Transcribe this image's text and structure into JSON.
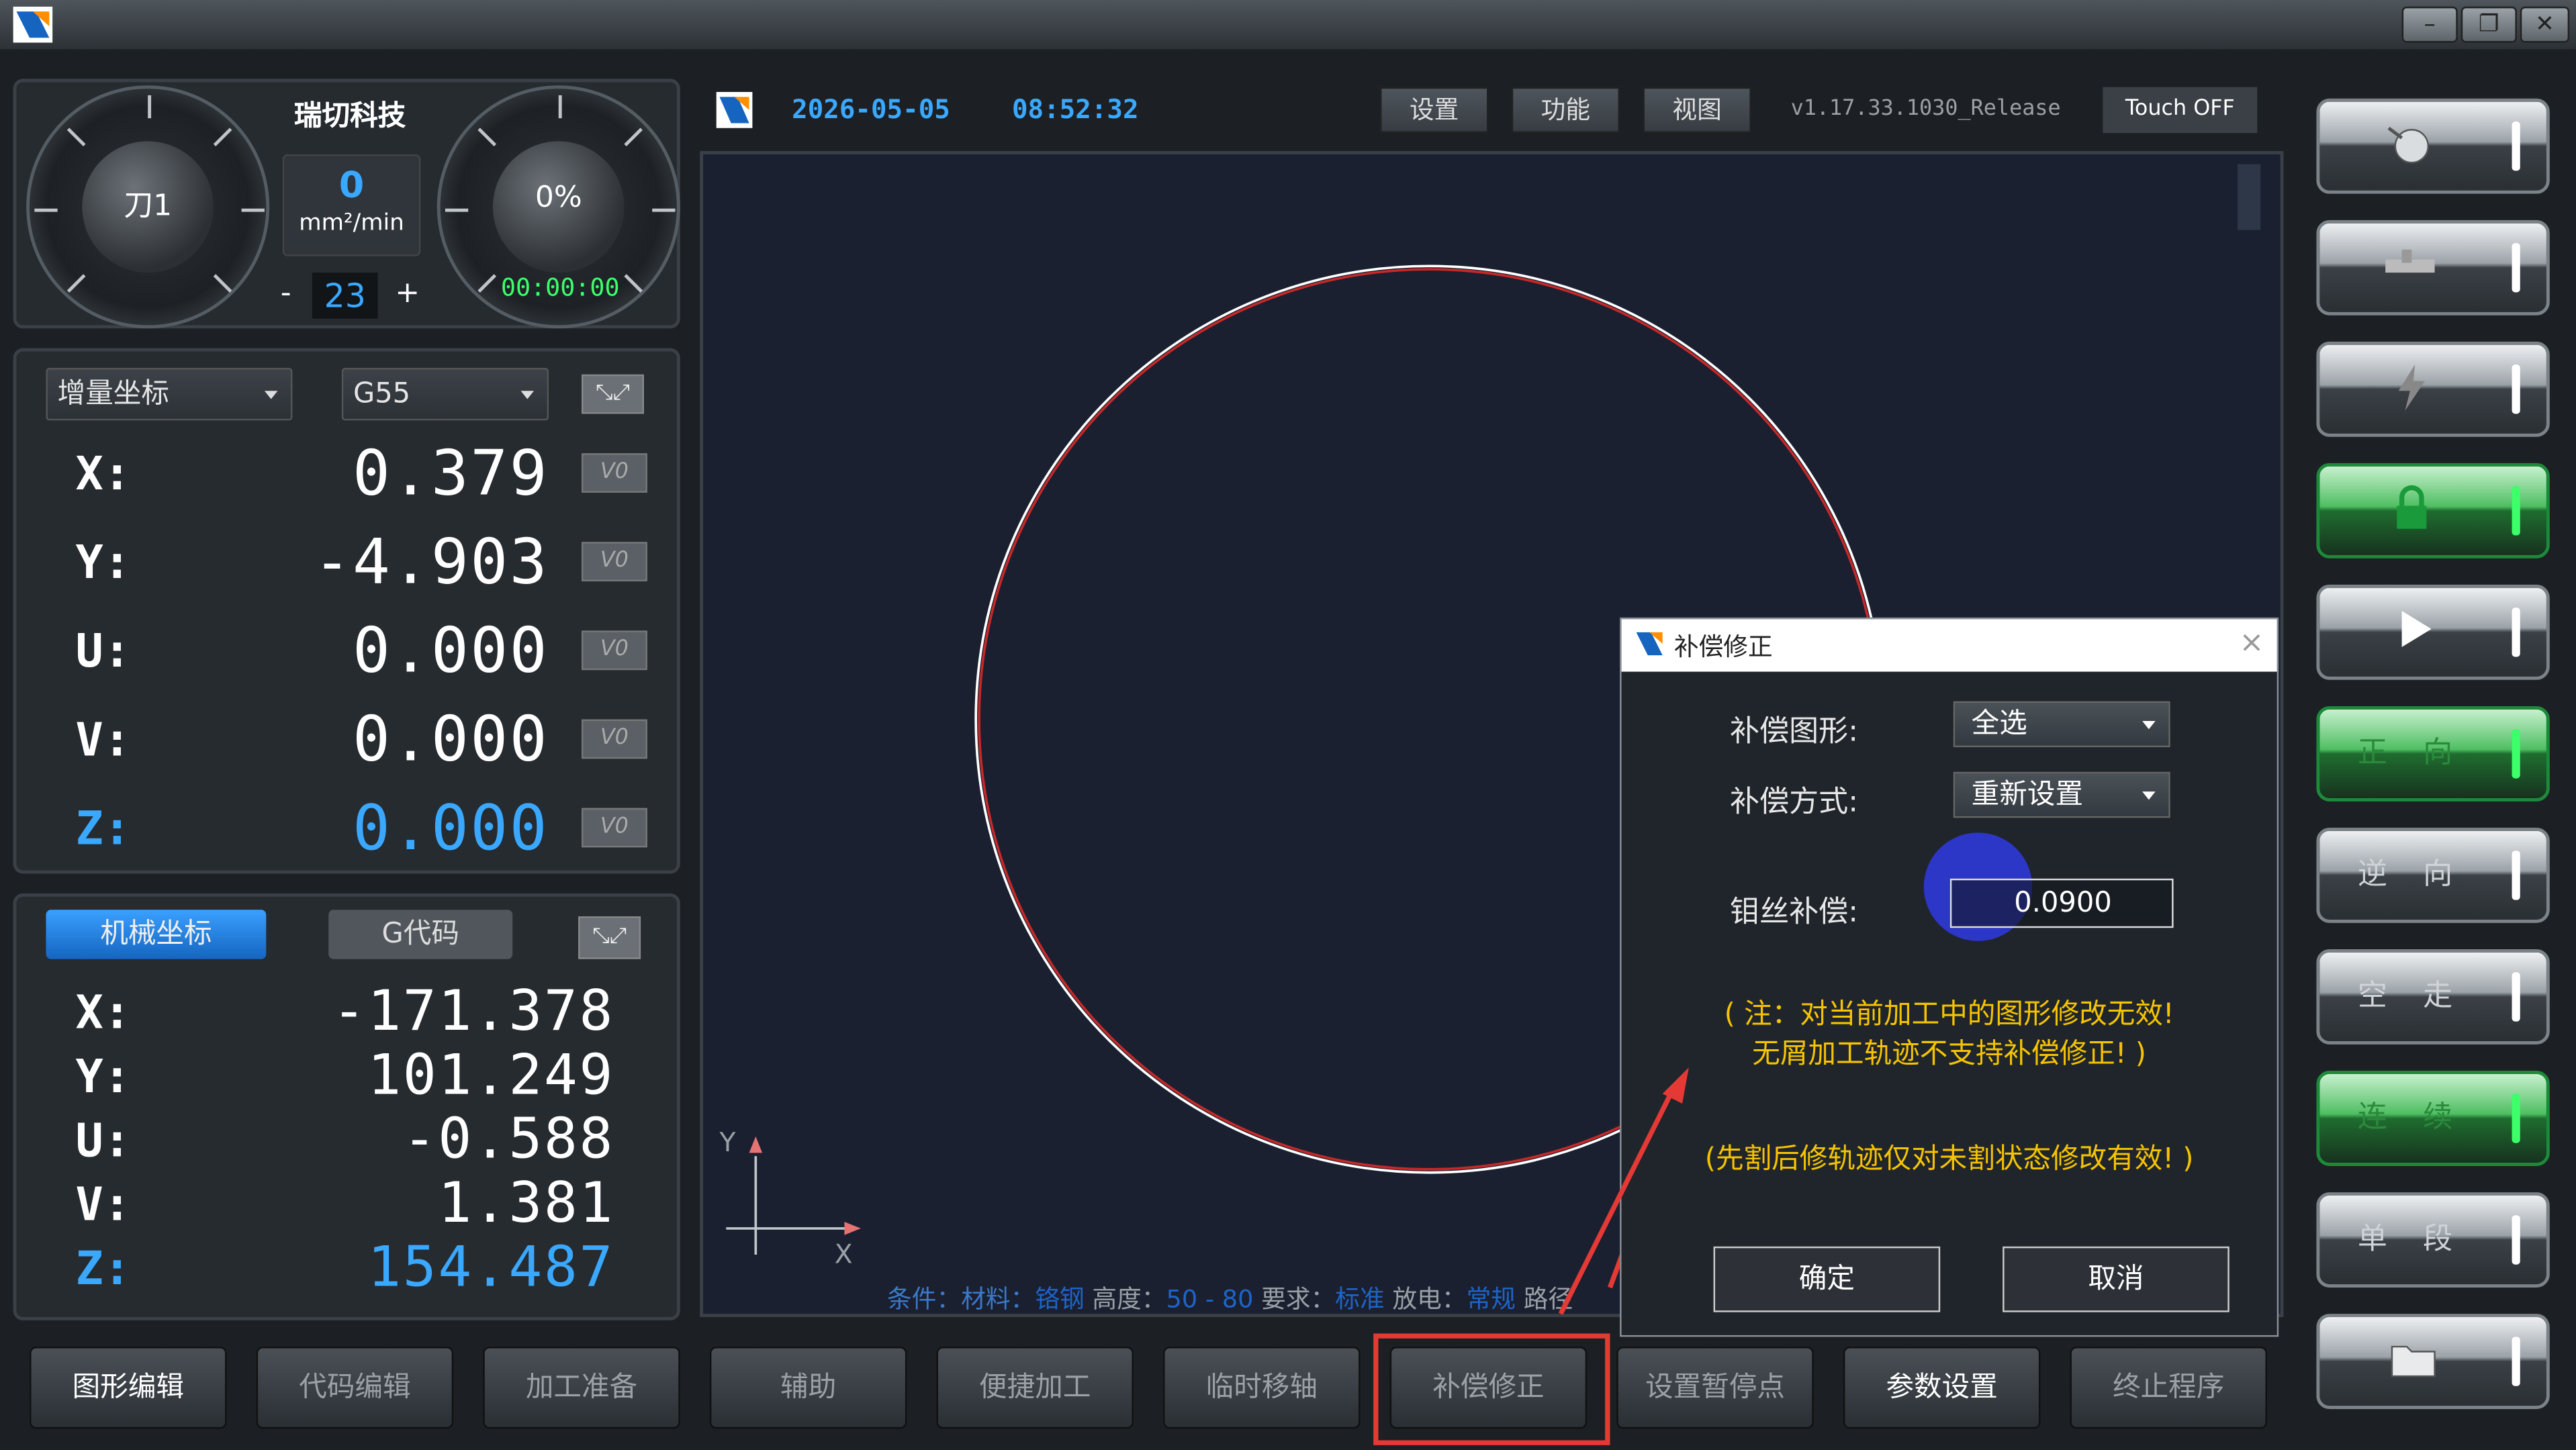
{
  "app": {
    "brand": "瑞切科技",
    "accent": "#3aa8ff"
  },
  "header": {
    "date": "2026-05-05",
    "time": "08:52:32",
    "menu": [
      "设置",
      "功能",
      "视图"
    ],
    "version": "v1.17.33.1030_Release",
    "touch": "Touch OFF"
  },
  "gauges": {
    "tool": "刀1",
    "speed_value": "0",
    "speed_unit": "mm²/min",
    "step_minus": "-",
    "step_value": "23",
    "step_plus": "+",
    "percent": "0%",
    "timer": "00:00:00"
  },
  "coords": {
    "mode": "增量坐标",
    "wcs": "G55",
    "vzero_label": "V0",
    "axes": [
      {
        "label": "X:",
        "value": "0.379"
      },
      {
        "label": "Y:",
        "value": "-4.903"
      },
      {
        "label": "U:",
        "value": "0.000"
      },
      {
        "label": "V:",
        "value": "0.000"
      },
      {
        "label": "Z:",
        "value": "0.000"
      }
    ]
  },
  "machine": {
    "tab_active": "机械坐标",
    "tab_inactive": "G代码",
    "axes": [
      {
        "label": "X:",
        "value": "-171.378"
      },
      {
        "label": "Y:",
        "value": "101.249"
      },
      {
        "label": "U:",
        "value": "-0.588"
      },
      {
        "label": "V:",
        "value": "1.381"
      },
      {
        "label": "Z:",
        "value": "154.487"
      }
    ]
  },
  "canvas": {
    "axis_y": "Y",
    "axis_x": "X",
    "status_parts": [
      "条件：材料：",
      "铬钢",
      "高度：",
      "50 - 80",
      "要求：",
      "标准",
      "放电：",
      "常规",
      "路径"
    ]
  },
  "dialog": {
    "title": "补偿修正",
    "close": "×",
    "shape_label": "补偿图形:",
    "shape_value": "全选",
    "method_label": "补偿方式:",
    "method_value": "重新设置",
    "wire_label": "钼丝补偿:",
    "wire_value": "0.0900",
    "note1": "( 注：对当前加工中的图形修改无效!",
    "note2": "无屑加工轨迹不支持补偿修正! )",
    "note3": "(先割后修轨迹仅对未割状态修改有效! )",
    "ok": "确定",
    "cancel": "取消"
  },
  "side": {
    "labels": [
      "",
      "",
      "",
      "",
      "",
      "正 向",
      "逆 向",
      "空 走",
      "连 续",
      "单 段",
      ""
    ]
  },
  "bottom": {
    "buttons": [
      "图形编辑",
      "代码编辑",
      "加工准备",
      "辅助",
      "便捷加工",
      "临时移轴",
      "补偿修正",
      "设置暂停点",
      "参数设置",
      "终止程序"
    ]
  }
}
